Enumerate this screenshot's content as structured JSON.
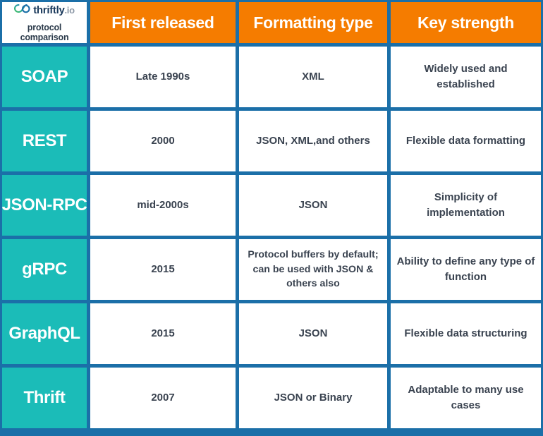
{
  "brand": {
    "logo_icon": "thriftly-infinity-logo-icon",
    "name": "thriftly",
    "tld": ".io",
    "subtitle_line1": "protocol",
    "subtitle_line2": "comparison"
  },
  "colors": {
    "border_blue": "#1B6FA8",
    "header_orange": "#F57C00",
    "protocol_teal": "#1BBCB8",
    "body_text": "#3A4350",
    "white": "#FFFFFF",
    "logo_green": "#3FBF61",
    "logo_blue": "#1B6FA8",
    "logo_word": "#1B3A5C",
    "logo_tld": "#8C98A6"
  },
  "table": {
    "columns": [
      "",
      "First released",
      "Formatting type",
      "Key strength"
    ],
    "rows": [
      {
        "protocol": "SOAP",
        "first_released": "Late 1990s",
        "formatting_type": "XML",
        "key_strength": "Widely used and established"
      },
      {
        "protocol": "REST",
        "first_released": "2000",
        "formatting_type": "JSON, XML,\nand others",
        "key_strength": "Flexible data formatting"
      },
      {
        "protocol": "JSON-\nRPC",
        "first_released": "mid-2000s",
        "formatting_type": "JSON",
        "key_strength": "Simplicity of implementation"
      },
      {
        "protocol": "gRPC",
        "first_released": "2015",
        "formatting_type": "Protocol buffers by default; can be used with JSON & others also",
        "key_strength": "Ability to define any type of function"
      },
      {
        "protocol": "GraphQL",
        "first_released": "2015",
        "formatting_type": "JSON",
        "key_strength": "Flexible data structuring"
      },
      {
        "protocol": "Thrift",
        "first_released": "2007",
        "formatting_type": "JSON or Binary",
        "key_strength": "Adaptable to many use cases"
      }
    ]
  }
}
